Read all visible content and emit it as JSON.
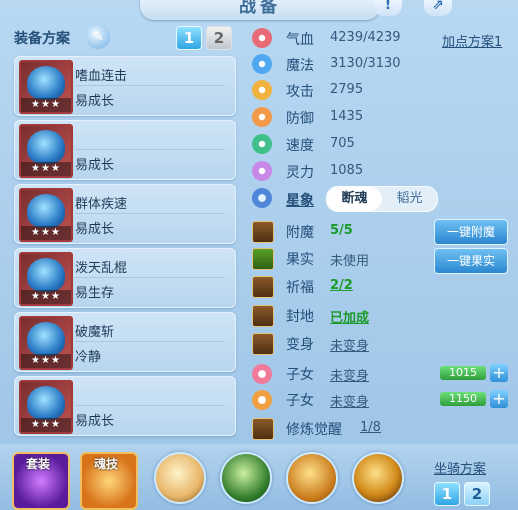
{
  "header": {
    "title": "战备",
    "help_icon": "!",
    "share_icon": "share-icon"
  },
  "left": {
    "scheme_label": "装备方案",
    "tabs": [
      "1",
      "2"
    ],
    "active_tab": 0,
    "cards": [
      {
        "skill": "嗜血连击",
        "trait": "易成长",
        "stars": "★★★"
      },
      {
        "skill": "",
        "trait": "易成长",
        "stars": "★★★"
      },
      {
        "skill": "群体疾速",
        "trait": "易成长",
        "stars": "★★★"
      },
      {
        "skill": "泼天乱棍",
        "trait": "易生存",
        "stars": "★★★"
      },
      {
        "skill": "破魔斩",
        "trait": "冷静",
        "stars": "★★★"
      },
      {
        "skill": "",
        "trait": "易成长",
        "stars": "★★★"
      }
    ]
  },
  "stats": {
    "add_points": "加点方案1",
    "rows": [
      {
        "name": "气血",
        "value": "4239/4239",
        "color": "#e86b78"
      },
      {
        "name": "魔法",
        "value": "3130/3130",
        "color": "#4fa8f0"
      },
      {
        "name": "攻击",
        "value": "2795",
        "color": "#f0b340"
      },
      {
        "name": "防御",
        "value": "1435",
        "color": "#f29a4a"
      },
      {
        "name": "速度",
        "value": "705",
        "color": "#3fc08a"
      },
      {
        "name": "灵力",
        "value": "1085",
        "color": "#c888e8"
      }
    ],
    "star_label": "星象",
    "star_options": [
      "断魂",
      "韬光"
    ]
  },
  "items": {
    "rows": [
      {
        "name": "附魔",
        "value": "5/5"
      },
      {
        "name": "果实",
        "value": "未使用"
      },
      {
        "name": "祈福",
        "value": "2/2"
      },
      {
        "name": "封地",
        "value": "已加成"
      },
      {
        "name": "变身",
        "value": "未变身"
      },
      {
        "name": "子女",
        "value": "未变身",
        "bar": "1015"
      },
      {
        "name": "子女",
        "value": "未变身",
        "bar": "1150"
      },
      {
        "name": "修炼觉醒",
        "value": "1/8"
      }
    ],
    "btn_enchant": "一键附魔",
    "btn_fruit": "一键果实"
  },
  "bottom": {
    "suit_label": "套装",
    "hunji_label": "魂技",
    "mount_label": "坐骑方案",
    "mount_tabs": [
      "1",
      "2"
    ]
  }
}
